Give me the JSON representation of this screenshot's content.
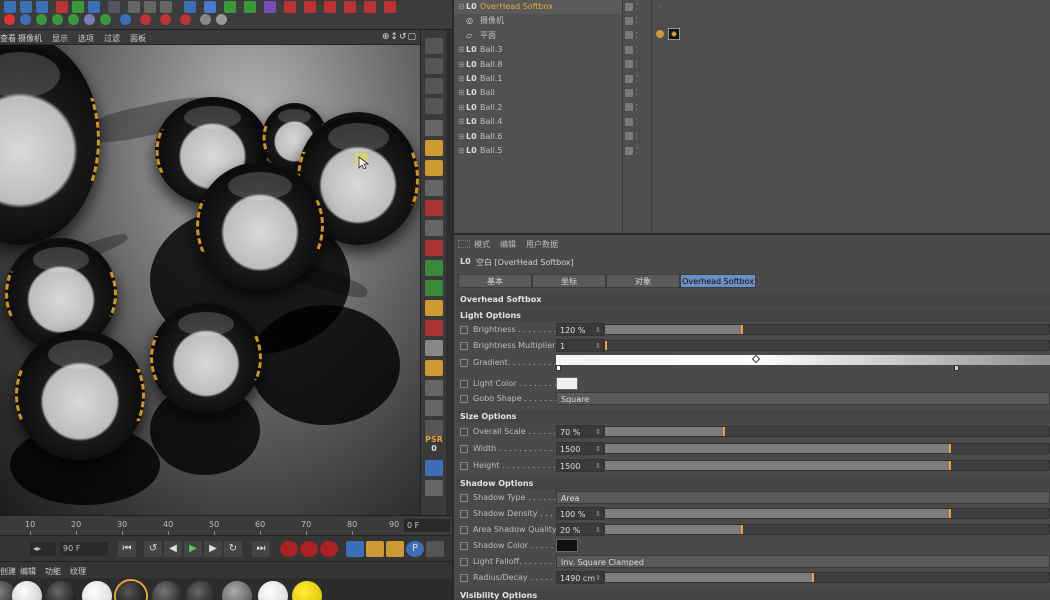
{
  "viewport": {
    "menu": [
      "查看",
      "摄像机",
      "显示",
      "选项",
      "过滤",
      "面板"
    ],
    "nav_icons": "⊕↕↺▢"
  },
  "timeline": {
    "ticks": [
      "10",
      "20",
      "30",
      "40",
      "50",
      "60",
      "70",
      "80",
      "90"
    ],
    "current_frame": "0 F"
  },
  "transport": {
    "start_frame": "◂▸",
    "end_frame": "90 F",
    "buttons": [
      "⏮",
      "↺",
      "◀",
      "▶",
      "▶",
      "↻",
      "⏭"
    ]
  },
  "material_manager": {
    "menu": [
      "创建",
      "编辑",
      "功能",
      "纹理"
    ]
  },
  "object_manager": {
    "objects": [
      {
        "name": "OverHead Softbox",
        "icon": "L0",
        "expand": "⊟",
        "selected": true,
        "color": "#e8a43a"
      },
      {
        "name": "摄像机",
        "icon": "◎",
        "expand": "",
        "selected": false,
        "color": "#bfbfbf"
      },
      {
        "name": "平面",
        "icon": "▱",
        "expand": "",
        "selected": false,
        "color": "#bfbfbf"
      },
      {
        "name": "Ball.3",
        "icon": "L0",
        "expand": "⊞",
        "selected": false,
        "color": "#bfbfbf"
      },
      {
        "name": "Ball.8",
        "icon": "L0",
        "expand": "⊞",
        "selected": false,
        "color": "#bfbfbf"
      },
      {
        "name": "Ball.1",
        "icon": "L0",
        "expand": "⊞",
        "selected": false,
        "color": "#bfbfbf"
      },
      {
        "name": "Ball",
        "icon": "L0",
        "expand": "⊞",
        "selected": false,
        "color": "#bfbfbf"
      },
      {
        "name": "Ball.2",
        "icon": "L0",
        "expand": "⊞",
        "selected": false,
        "color": "#bfbfbf"
      },
      {
        "name": "Ball.4",
        "icon": "L0",
        "expand": "⊞",
        "selected": false,
        "color": "#bfbfbf"
      },
      {
        "name": "Ball.6",
        "icon": "L0",
        "expand": "⊞",
        "selected": false,
        "color": "#bfbfbf"
      },
      {
        "name": "Ball.5",
        "icon": "L0",
        "expand": "⊞",
        "selected": false,
        "color": "#bfbfbf"
      }
    ]
  },
  "attribute_manager": {
    "menu": [
      "模式",
      "编辑",
      "用户数据"
    ],
    "title": "空白 [OverHead Softbox]",
    "tabs": [
      "基本",
      "坐标",
      "对象",
      "Overhead Softbox"
    ],
    "active_tab": 3,
    "header": "Overhead Softbox",
    "sections": {
      "light": "Light Options",
      "size": "Size Options",
      "shadow": "Shadow Options",
      "visibility": "Visibility Options"
    },
    "params": {
      "brightness": {
        "label": "Brightness . . . . . . . . .",
        "value": "120 %",
        "fill": 0.31
      },
      "brightness_mult": {
        "label": "Brightness Multiplier",
        "value": "1",
        "fill": 0.0
      },
      "gradient": {
        "label": "Gradient. . . . . . . . . ."
      },
      "light_color": {
        "label": "Light Color . . . . . . . .",
        "color": "#f0f0f0"
      },
      "gobo_shape": {
        "label": "Gobo Shape . . . . . . . .",
        "value": "Square"
      },
      "overall_scale": {
        "label": "Overall Scale . . . . . . .",
        "value": "70 %",
        "fill": 0.27
      },
      "width": {
        "label": "Width . . . . . . . . . . . .",
        "value": "1500",
        "fill": 0.78
      },
      "height": {
        "label": "Height . . . . . . . . . . . .",
        "value": "1500",
        "fill": 0.78
      },
      "shadow_type": {
        "label": "Shadow Type . . . . . . . .",
        "value": "Area"
      },
      "shadow_density": {
        "label": "Shadow Density . . . . . .",
        "value": "100 %",
        "fill": 0.78
      },
      "area_shadow_quality": {
        "label": "Area Shadow Quality",
        "value": "20 %",
        "fill": 0.31
      },
      "shadow_color": {
        "label": "Shadow Color . . . . . . .",
        "color": "#111111"
      },
      "light_falloff": {
        "label": "Light Falloff. . . . . . . .",
        "value": "Inv. Square Clamped"
      },
      "radius_decay": {
        "label": "Radius/Decay . . . . . . .",
        "value": "1490 cm",
        "fill": 0.47
      }
    }
  }
}
